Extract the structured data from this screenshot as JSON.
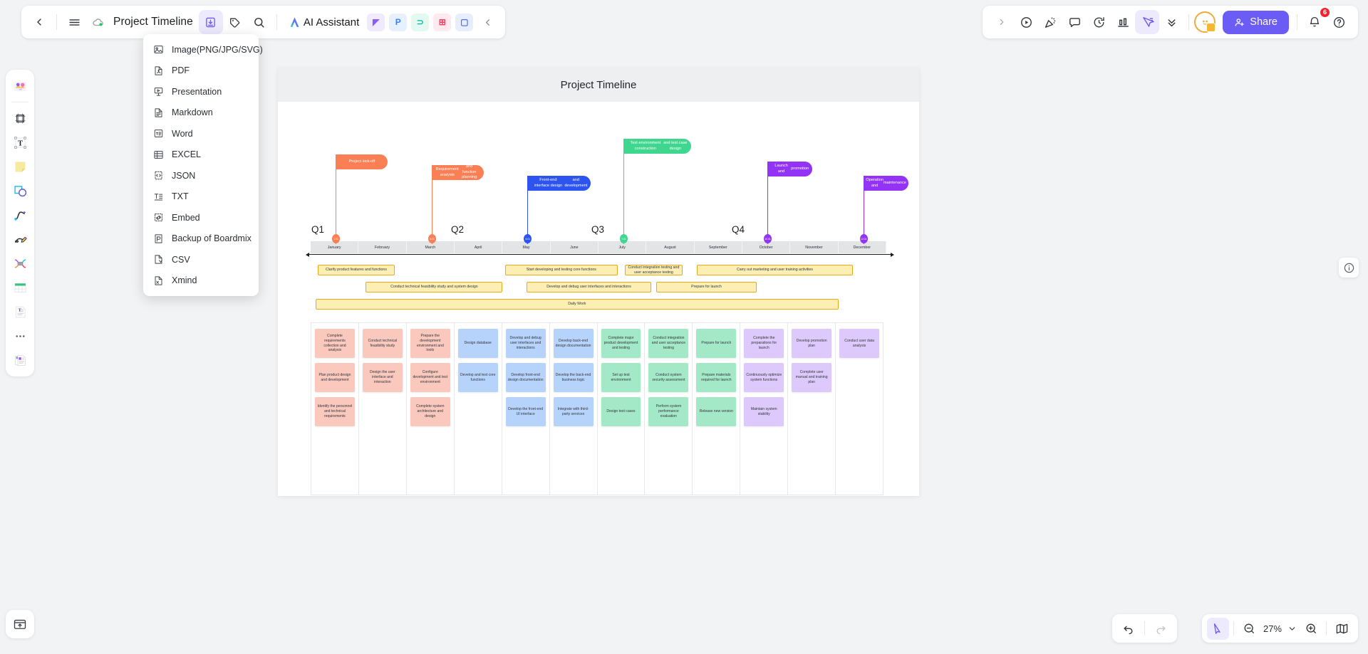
{
  "topbar": {
    "back_icon": "chevron-left-icon",
    "menu_icon": "hamburger-menu-icon",
    "cloud_icon": "cloud-saved-icon",
    "doc_title": "Project Timeline",
    "export_icon": "export-download-icon",
    "tag_icon": "tag-icon",
    "search_icon": "search-icon",
    "ai_label": "AI Assistant",
    "mini_apps": [
      {
        "name": "image-app",
        "glyph": "◤",
        "bg": "#f0eafe",
        "color": "#8b5cf6"
      },
      {
        "name": "presentation-app",
        "glyph": "P",
        "bg": "#e7f1fe",
        "color": "#3b82f6"
      },
      {
        "name": "mindmap-app",
        "glyph": "⊃",
        "bg": "#e4faf1",
        "color": "#14b8a6"
      },
      {
        "name": "table-app",
        "glyph": "⊞",
        "bg": "#ffeaf0",
        "color": "#f43f5e"
      },
      {
        "name": "chat-app",
        "glyph": "▢",
        "bg": "#e8eefe",
        "color": "#4f6ef7"
      }
    ],
    "collapse_icon": "chevron-left-icon"
  },
  "topbar_right": {
    "expand_icon": "chevron-right-icon",
    "tools": [
      {
        "name": "present-play-icon"
      },
      {
        "name": "confetti-icon"
      },
      {
        "name": "comment-icon"
      },
      {
        "name": "timer-icon"
      },
      {
        "name": "chart-icon"
      },
      {
        "name": "cursor-select-icon",
        "active": true
      },
      {
        "name": "chevron-double-down-icon"
      }
    ],
    "avatar_name": "avatar",
    "share_label": "Share",
    "notification_count": "6",
    "help_icon": "help-circle-icon"
  },
  "export_menu": {
    "items": [
      {
        "label": "Image(PNG/JPG/SVG)",
        "icon": "image-icon"
      },
      {
        "label": "PDF",
        "icon": "pdf-file-icon"
      },
      {
        "label": "Presentation",
        "icon": "presentation-icon"
      },
      {
        "label": "Markdown",
        "icon": "markdown-file-icon"
      },
      {
        "label": "Word",
        "icon": "word-file-icon"
      },
      {
        "label": "EXCEL",
        "icon": "excel-table-icon"
      },
      {
        "label": "JSON",
        "icon": "json-code-icon"
      },
      {
        "label": "TXT",
        "icon": "text-file-icon"
      },
      {
        "label": "Embed",
        "icon": "embed-link-icon"
      },
      {
        "label": "Backup of Boardmix",
        "icon": "backup-file-icon"
      },
      {
        "label": "CSV",
        "icon": "csv-file-icon"
      },
      {
        "label": "Xmind",
        "icon": "xmind-file-icon"
      }
    ]
  },
  "left_rail": {
    "items": [
      {
        "name": "templates-tool"
      },
      {
        "name": "frame-tool"
      },
      {
        "name": "text-tool"
      },
      {
        "name": "sticky-note-tool"
      },
      {
        "name": "shape-tool"
      },
      {
        "name": "connector-tool"
      },
      {
        "name": "pen-draw-tool"
      },
      {
        "name": "mindmap-tool"
      },
      {
        "name": "table-tool"
      },
      {
        "name": "document-tool"
      },
      {
        "name": "more-tools"
      },
      {
        "name": "assets-tool"
      }
    ],
    "bottom_item": "upload-file-tool"
  },
  "board": {
    "title": "Project Timeline",
    "info_icon": "info-circle-icon"
  },
  "chart_data": {
    "type": "table",
    "title": "Project Timeline",
    "quarters": [
      "Q1",
      "Q2",
      "Q3",
      "Q4"
    ],
    "months": [
      "January",
      "February",
      "March",
      "April",
      "May",
      "June",
      "July",
      "August",
      "September",
      "October",
      "November",
      "December"
    ],
    "milestones": [
      {
        "label": "Project kick-off",
        "month": "January",
        "color": "#fa7f54",
        "dot": "1.01"
      },
      {
        "label": "Requirement analysis\nand function planning",
        "month": "March",
        "color": "#fa7f54",
        "dot": "3.01"
      },
      {
        "label": "Front-end interface design\nand development",
        "month": "May",
        "color": "#2d54f0",
        "dot": "5.01"
      },
      {
        "label": "Test environment construction\nand test case design",
        "month": "July",
        "color": "#3fd68f",
        "dot": "7.01"
      },
      {
        "label": "Launch and\npromotion",
        "month": "October",
        "color": "#9333f5",
        "dot": "10.01"
      },
      {
        "label": "Operation and\nmaintenance",
        "month": "December",
        "color": "#9333f5",
        "dot": "12.01"
      }
    ],
    "task_bars": [
      {
        "label": "Clarify product features and functions",
        "row": 1,
        "start": 0.15,
        "end": 1.75
      },
      {
        "label": "Start developing and testing core functions",
        "row": 1,
        "start": 4.05,
        "end": 6.4
      },
      {
        "label": "Conduct integration testing and user acceptance testing",
        "row": 1,
        "start": 6.55,
        "end": 7.75
      },
      {
        "label": "Carry out marketing and user training activities",
        "row": 1,
        "start": 8.05,
        "end": 11.3
      },
      {
        "label": "Conduct technical feasibility study and system design",
        "row": 2,
        "start": 1.15,
        "end": 4.0
      },
      {
        "label": "Develop and debug user interfaces and interactions",
        "row": 2,
        "start": 4.5,
        "end": 7.1
      },
      {
        "label": "Prepare for launch",
        "row": 2,
        "start": 7.2,
        "end": 9.3
      },
      {
        "label": "Daily Work",
        "row": 3,
        "start": 0.1,
        "end": 11.0
      }
    ],
    "columns": [
      {
        "color": "#fac8bd",
        "cards": [
          "Complete requirements collection and analysis",
          "Plan product design and development",
          "Identify the personnel and technical requirements"
        ]
      },
      {
        "color": "#fac8bd",
        "cards": [
          "Conduct technical feasibility study",
          "Design the user interface and interaction"
        ]
      },
      {
        "color": "#fac8bd",
        "cards": [
          "Prepare the development environment and tools",
          "Configure development and test environment",
          "Complete system architecture and design"
        ]
      },
      {
        "color": "#b6d3fb",
        "cards": [
          "Design database",
          "Develop and test core functions"
        ]
      },
      {
        "color": "#b6d3fb",
        "cards": [
          "Develop and debug user interfaces and interactions",
          "Develop front-end design documentation",
          "Develop the front-end UI interface"
        ]
      },
      {
        "color": "#b6d3fb",
        "cards": [
          "Develop back-end design documentation",
          "Develop the back-end business logic",
          "Integrate with third-party services"
        ]
      },
      {
        "color": "#a3e9c8",
        "cards": [
          "Complete major product development and testing",
          "Set up test environment",
          "Design test cases"
        ]
      },
      {
        "color": "#a3e9c8",
        "cards": [
          "Conduct integration and user acceptance testing",
          "Conduct system security assessment",
          "Perform system performance evaluation"
        ]
      },
      {
        "color": "#a3e9c8",
        "cards": [
          "Prepare for launch",
          "Prepare materials required for launch",
          "Release new version"
        ]
      },
      {
        "color": "#ddc9fb",
        "cards": [
          "Complete the preparations for launch",
          "Continuously optimize system functions",
          "Maintain system stability"
        ]
      },
      {
        "color": "#ddc9fb",
        "cards": [
          "Develop promotion plan",
          "Complete user manual and training plan"
        ]
      },
      {
        "color": "#ddc9fb",
        "cards": [
          "Conduct user data analysis"
        ]
      }
    ]
  },
  "bottom": {
    "undo_icon": "undo-icon",
    "redo_icon": "redo-icon",
    "cursor_icon": "cursor-select-icon",
    "zoom_out_icon": "zoom-out-icon",
    "zoom_level": "27%",
    "zoom_dropdown_icon": "chevron-down-icon",
    "zoom_in_icon": "zoom-in-icon",
    "minimap_icon": "minimap-icon"
  }
}
